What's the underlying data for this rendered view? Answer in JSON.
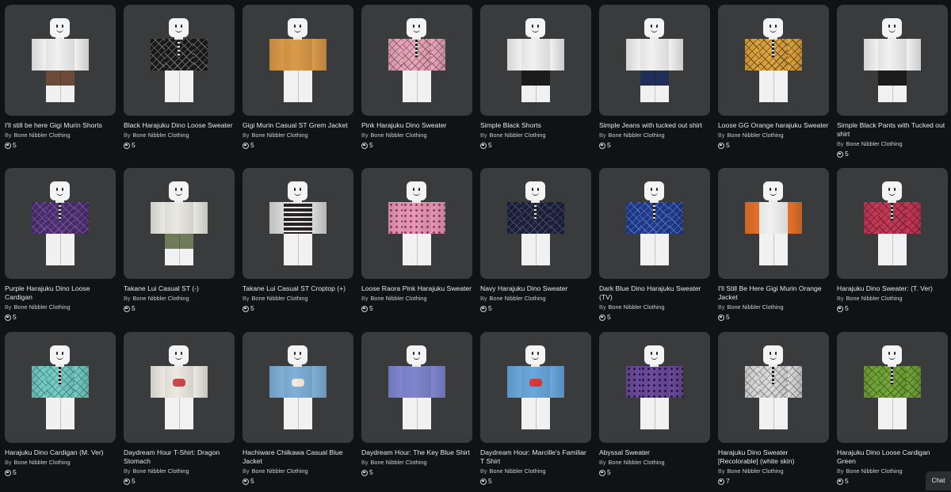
{
  "creator_prefix": "By",
  "chat_label": "Chat",
  "items": [
    {
      "name": "I'll still be here Gigi Murin Shorts",
      "creator": "Bone Nibbler Clothing",
      "price": "5",
      "shirt": "#f1f1f1",
      "sleeves": "#f1f1f1",
      "pants": "#6b4a3a",
      "tie": false,
      "pattern": "none",
      "patternColor": "#ffffff"
    },
    {
      "name": "Black Harajuku Dino Loose Sweater",
      "creator": "Bone Nibbler Clothing",
      "price": "5",
      "shirt": "#1a1a1a",
      "sleeves": "#1a1a1a",
      "pants": "#f1f1f1",
      "tie": true,
      "pattern": "dino",
      "patternColor": "#777777"
    },
    {
      "name": "Gigi Murin Casual ST Grem Jacket",
      "creator": "Bone Nibbler Clothing",
      "price": "5",
      "shirt": "#d99a4a",
      "sleeves": "#d99a4a",
      "pants": "#f1f1f1",
      "tie": false,
      "pattern": "none",
      "patternColor": "#ffffff"
    },
    {
      "name": "Pink Harajuku Dino Sweater",
      "creator": "Bone Nibbler Clothing",
      "price": "5",
      "shirt": "#e7a9bd",
      "sleeves": "#e7a9bd",
      "pants": "#f1f1f1",
      "tie": true,
      "pattern": "dino",
      "patternColor": "#9b5a6c"
    },
    {
      "name": "Simple Black Shorts",
      "creator": "Bone Nibbler Clothing",
      "price": "5",
      "shirt": "#f1f1f1",
      "sleeves": "#f1f1f1",
      "pants": "#1b1b1b",
      "tie": false,
      "pattern": "none",
      "patternColor": "#ffffff"
    },
    {
      "name": "Simple Jeans with tucked out shirt",
      "creator": "Bone Nibbler Clothing",
      "price": "5",
      "shirt": "#f1f1f1",
      "sleeves": "#f1f1f1",
      "pants": "#1f2f55",
      "tie": false,
      "pattern": "none",
      "patternColor": "#ffffff"
    },
    {
      "name": "Loose GG Orange harajuku Sweater",
      "creator": "Bone Nibbler Clothing",
      "price": "5",
      "shirt": "#e0a63f",
      "sleeves": "#e0a63f",
      "pants": "#f1f1f1",
      "tie": true,
      "pattern": "dino",
      "patternColor": "#6a4a1d"
    },
    {
      "name": "Simple Black Pants with Tucked out shirt",
      "creator": "Bone Nibbler Clothing",
      "price": "5",
      "shirt": "#f1f1f1",
      "sleeves": "#f1f1f1",
      "pants": "#1b1b1b",
      "tie": false,
      "pattern": "none",
      "patternColor": "#ffffff"
    },
    {
      "name": "Purple Harajuku Dino Loose Cardigan",
      "creator": "Bone Nibbler Clothing",
      "price": "5",
      "shirt": "#4b2d6e",
      "sleeves": "#4b2d6e",
      "pants": "#f1f1f1",
      "tie": true,
      "pattern": "dino",
      "patternColor": "#7c5ca2"
    },
    {
      "name": "Takane Lui Casual ST (-)",
      "creator": "Bone Nibbler Clothing",
      "price": "5",
      "shirt": "#e9e9e2",
      "sleeves": "#e9e9e2",
      "pants": "#6f7a5a",
      "tie": false,
      "pattern": "none",
      "patternColor": "#ffffff"
    },
    {
      "name": "Takane Lui Casual ST Croptop (+)",
      "creator": "Bone Nibbler Clothing",
      "price": "5",
      "shirt": "#2a2323",
      "sleeves": "#d9d9d9",
      "pants": "#f1f1f1",
      "tie": false,
      "pattern": "stripes",
      "patternColor": "#f1f1f1"
    },
    {
      "name": "Loose Raora Pink Harajuku Sweater",
      "creator": "Bone Nibbler Clothing",
      "price": "5",
      "shirt": "#e996b5",
      "sleeves": "#e996b5",
      "pants": "#f1f1f1",
      "tie": false,
      "pattern": "dots",
      "patternColor": "#7b3f55"
    },
    {
      "name": "Navy Harajuku Dino Sweater",
      "creator": "Bone Nibbler Clothing",
      "price": "5",
      "shirt": "#1c2038",
      "sleeves": "#1c2038",
      "pants": "#f1f1f1",
      "tie": true,
      "pattern": "dino",
      "patternColor": "#4b5273"
    },
    {
      "name": "Dark Blue Dino Harajuku Sweater (TV)",
      "creator": "Bone Nibbler Clothing",
      "price": "5",
      "shirt": "#1f3a8a",
      "sleeves": "#1f3a8a",
      "pants": "#f1f1f1",
      "tie": true,
      "pattern": "dino",
      "patternColor": "#5b78c6"
    },
    {
      "name": "I'll Still Be Here Gigi Murin Orange Jacket",
      "creator": "Bone Nibbler Clothing",
      "price": "5",
      "shirt": "#f1f1f1",
      "sleeves": "#e5722c",
      "pants": "#f1f1f1",
      "tie": false,
      "pattern": "none",
      "patternColor": "#ffffff"
    },
    {
      "name": "Harajuku Dino Sweater: (T. Ver)",
      "creator": "Bone Nibbler Clothing",
      "price": "5",
      "shirt": "#c53a58",
      "sleeves": "#c53a58",
      "pants": "#f1f1f1",
      "tie": true,
      "pattern": "dino",
      "patternColor": "#7c1f33"
    },
    {
      "name": "Harajuku Dino Cardigan (M. Ver)",
      "creator": "Bone Nibbler Clothing",
      "price": "5",
      "shirt": "#78cec6",
      "sleeves": "#78cec6",
      "pants": "#f1f1f1",
      "tie": true,
      "pattern": "dino",
      "patternColor": "#3f8f88"
    },
    {
      "name": "Daydream Hour T-Shirt: Dragon Stomach",
      "creator": "Bone Nibbler Clothing",
      "price": "5",
      "shirt": "#ece9e2",
      "sleeves": "#ece9e2",
      "pants": "#f1f1f1",
      "tie": false,
      "pattern": "print",
      "patternColor": "#c94a4a"
    },
    {
      "name": "Hachiware Chiikawa Casual Blue Jacket",
      "creator": "Bone Nibbler Clothing",
      "price": "5",
      "shirt": "#7fb0d8",
      "sleeves": "#7fb0d8",
      "pants": "#f1f1f1",
      "tie": false,
      "pattern": "print",
      "patternColor": "#f3e9dc"
    },
    {
      "name": "Daydream Hour: The Key Blue Shirt",
      "creator": "Bone Nibbler Clothing",
      "price": "5",
      "shirt": "#7f86cf",
      "sleeves": "#7f86cf",
      "pants": "#f1f1f1",
      "tie": false,
      "pattern": "none",
      "patternColor": "#ffffff"
    },
    {
      "name": "Daydream Hour: Marcille's Familiar T Shirt",
      "creator": "Bone Nibbler Clothing",
      "price": "5",
      "shirt": "#6aa7dc",
      "sleeves": "#6aa7dc",
      "pants": "#f1f1f1",
      "tie": false,
      "pattern": "print",
      "patternColor": "#d43b3b"
    },
    {
      "name": "Abyssal Sweater",
      "creator": "Bone Nibbler Clothing",
      "price": "5",
      "shirt": "#6b4a9b",
      "sleeves": "#6b4a9b",
      "pants": "#f1f1f1",
      "tie": false,
      "pattern": "dots",
      "patternColor": "#1e1233"
    },
    {
      "name": "Harajuku Dino Sweater [Recolorable] (white skin)",
      "creator": "Bone Nibbler Clothing",
      "price": "7",
      "shirt": "#dcdcdc",
      "sleeves": "#dcdcdc",
      "pants": "#f1f1f1",
      "tie": true,
      "pattern": "dino",
      "patternColor": "#8a8a8a"
    },
    {
      "name": "Harajuku Dino Loose Cardigan Green",
      "creator": "Bone Nibbler Clothing",
      "price": "5",
      "shirt": "#76a63a",
      "sleeves": "#76a63a",
      "pants": "#f1f1f1",
      "tie": true,
      "pattern": "dino",
      "patternColor": "#3e6a1b"
    }
  ]
}
